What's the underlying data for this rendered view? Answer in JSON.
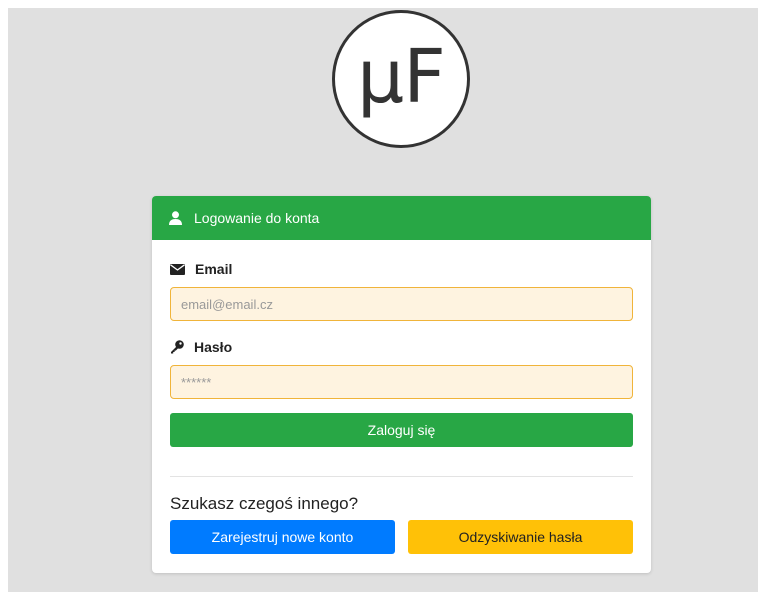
{
  "logo": {
    "text": "μF"
  },
  "card": {
    "header": "Logowanie do konta",
    "email": {
      "label": "Email",
      "placeholder": "email@email.cz",
      "value": ""
    },
    "password": {
      "label": "Hasło",
      "placeholder": "******",
      "value": ""
    },
    "login_button": "Zaloguj się",
    "question": "Szukasz czegoś innego?",
    "register_button": "Zarejestruj nowe konto",
    "recover_button": "Odzyskiwanie hasła"
  },
  "colors": {
    "header": "#28a745",
    "login": "#28a745",
    "register": "#007bff",
    "recover": "#ffc107",
    "input_bg": "#fef3e0",
    "input_border": "#f0b43a"
  },
  "icons": {
    "header": "user-icon",
    "email": "envelope-icon",
    "password": "key-icon"
  }
}
